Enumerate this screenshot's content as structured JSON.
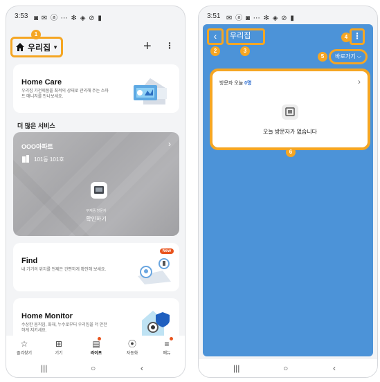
{
  "left": {
    "status": {
      "time": "3:53",
      "icons": "◙ ✉ ⓐ ⋯        ✻ ◈ ⊘ ▮"
    },
    "header": {
      "home_name": "우리집",
      "badge": "1"
    },
    "homecare": {
      "title": "Home Care",
      "desc": "우리집 가전제품을 최적의 상태로 관리해 주는 스마트 매니저를 만나보세요."
    },
    "section_title": "더 많은 서비스",
    "apartment": {
      "name": "OOO아파트",
      "unit": "101동 101호",
      "visitor_sub": "부재중 방문자",
      "visitor_main": "확인하기"
    },
    "find": {
      "title": "Find",
      "desc": "내 기기의 위치를 언제든 간편하게 확인해 보세요.",
      "badge": "New"
    },
    "monitor": {
      "title": "Home Monitor",
      "desc": "수상한 움직임, 화재, 누수로부터 우리집을 더 안전하게 지키세요."
    },
    "nav": [
      {
        "label": "즐겨찾기",
        "icon": "☆"
      },
      {
        "label": "기기",
        "icon": "⊞"
      },
      {
        "label": "라이프",
        "icon": "▤"
      },
      {
        "label": "자동화",
        "icon": "⦿"
      },
      {
        "label": "메뉴",
        "icon": "≡"
      }
    ]
  },
  "right": {
    "status": {
      "time": "3:51",
      "icons": "✉ ⓐ ◙ ⋯        ✻ ◈ ⊘ ▮"
    },
    "title": "우리집",
    "goto_label": "바로가기 ⌵",
    "visit": {
      "title_prefix": "방문자 오늘 ",
      "count": "0명",
      "empty": "오늘 방문자가 없습니다"
    },
    "badges": [
      "2",
      "3",
      "4",
      "5",
      "6"
    ]
  },
  "sysnav": {
    "recent": "|||",
    "home": "○",
    "back": "‹"
  },
  "colors": {
    "accent": "#f5a623",
    "blue": "#4c93d8",
    "notif": "#e8541e"
  }
}
